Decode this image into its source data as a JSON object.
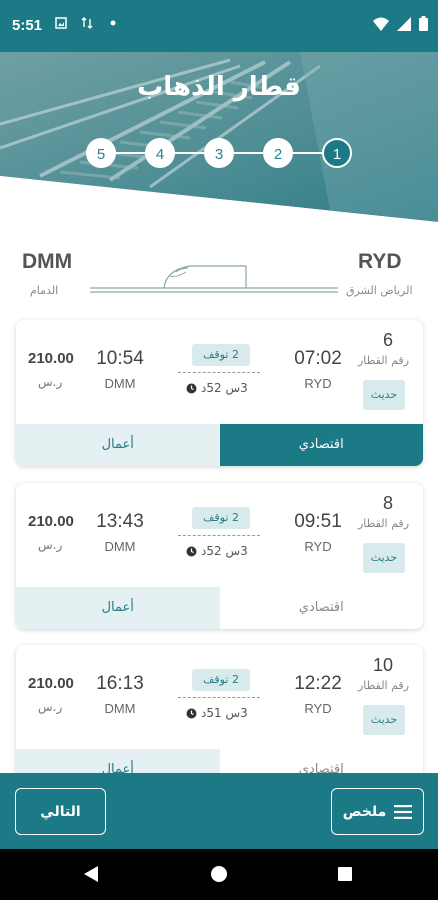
{
  "status_bar": {
    "time": "5:51",
    "left_icons": [
      "image-notification-icon",
      "data-transfer-icon",
      "dot-icon"
    ],
    "right_icons": [
      "wifi-icon",
      "cellular-signal-icon",
      "battery-icon"
    ]
  },
  "header": {
    "title": "قطار الذهاب",
    "steps": [
      "1",
      "2",
      "3",
      "4",
      "5"
    ],
    "active_step": "1"
  },
  "route": {
    "origin_code": "RYD",
    "origin_name": "الرياض الشرق",
    "destination_code": "DMM",
    "destination_name": "الدمام"
  },
  "trips": [
    {
      "train_number": "6",
      "train_label": "رقم القطار",
      "badge": "حديث",
      "departure_time": "07:02",
      "departure_code": "RYD",
      "stops": "2 توقف",
      "duration": "3س 52د",
      "arrival_time": "10:54",
      "arrival_code": "DMM",
      "price": "210.00",
      "currency": "ر.س",
      "economy_label": "اقتصادي",
      "business_label": "أعمال",
      "economy_selected": true
    },
    {
      "train_number": "8",
      "train_label": "رقم القطار",
      "badge": "حديث",
      "departure_time": "09:51",
      "departure_code": "RYD",
      "stops": "2 توقف",
      "duration": "3س 52د",
      "arrival_time": "13:43",
      "arrival_code": "DMM",
      "price": "210.00",
      "currency": "ر.س",
      "economy_label": "اقتصادي",
      "business_label": "أعمال",
      "economy_selected": false
    },
    {
      "train_number": "10",
      "train_label": "رقم القطار",
      "badge": "حديث",
      "departure_time": "12:22",
      "departure_code": "RYD",
      "stops": "2 توقف",
      "duration": "3س 51د",
      "arrival_time": "16:13",
      "arrival_code": "DMM",
      "price": "210.00",
      "currency": "ر.س",
      "economy_label": "اقتصادي",
      "business_label": "أعمال",
      "economy_selected": false
    }
  ],
  "footer": {
    "next_label": "التالي",
    "summary_label": "ملخص"
  },
  "colors": {
    "primary": "#1b7a86",
    "badge_bg": "#d8eaec",
    "business_bg": "#e4f0f1"
  }
}
